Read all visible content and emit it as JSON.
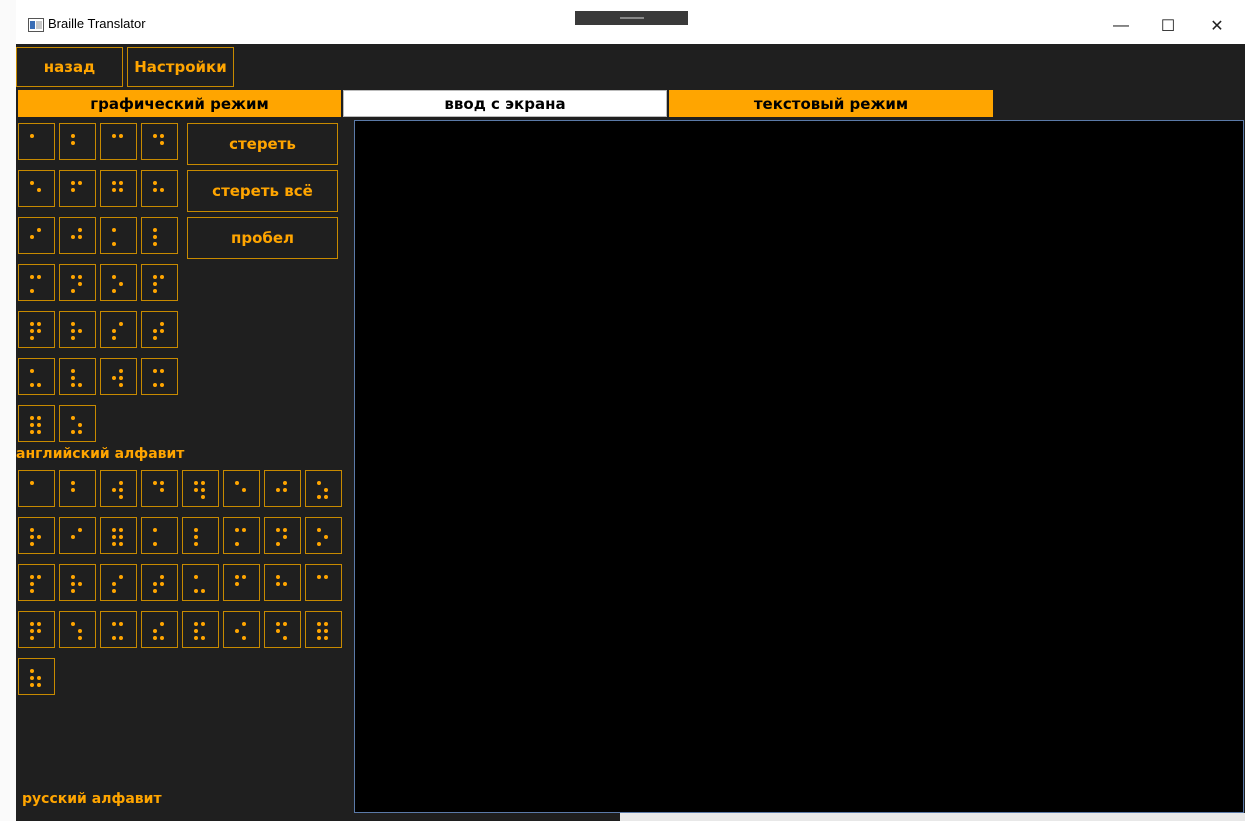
{
  "window": {
    "title": "Braille Translator",
    "controls": {
      "minimize": "—",
      "maximize": "☐",
      "close": "✕"
    }
  },
  "nav": {
    "back": "назад",
    "settings": "Настройки"
  },
  "tabs": [
    {
      "label": "графический режим",
      "active": false
    },
    {
      "label": "ввод с экрана",
      "active": true
    },
    {
      "label": "текстовый режим",
      "active": false
    }
  ],
  "actions": {
    "erase": "стереть",
    "erase_all": "стереть всё",
    "space": "пробел"
  },
  "sections": {
    "english": "английский алфавит",
    "russian": "русский алфавит"
  },
  "colors": {
    "accent": "#ffa500",
    "border": "#c78a00",
    "background": "#1f1f1f",
    "canvas": "#000000"
  },
  "english_cells": [
    [
      1
    ],
    [
      1,
      2
    ],
    [
      1,
      4
    ],
    [
      1,
      4,
      5
    ],
    [
      1,
      5
    ],
    [
      1,
      2,
      4
    ],
    [
      1,
      2,
      4,
      5
    ],
    [
      1,
      2,
      5
    ],
    [
      2,
      4
    ],
    [
      2,
      4,
      5
    ],
    [
      1,
      3
    ],
    [
      1,
      2,
      3
    ],
    [
      1,
      3,
      4
    ],
    [
      1,
      3,
      4,
      5
    ],
    [
      1,
      3,
      5
    ],
    [
      1,
      2,
      3,
      4
    ],
    [
      1,
      2,
      3,
      4,
      5
    ],
    [
      1,
      2,
      3,
      5
    ],
    [
      2,
      3,
      4
    ],
    [
      2,
      3,
      4,
      5
    ],
    [
      1,
      3,
      6
    ],
    [
      1,
      2,
      3,
      6
    ],
    [
      2,
      4,
      5,
      6
    ],
    [
      1,
      3,
      4,
      6
    ],
    [
      1,
      2,
      3,
      4,
      5,
      6
    ],
    [
      1,
      3,
      5,
      6
    ]
  ],
  "russian_cells": [
    [
      1
    ],
    [
      1,
      2
    ],
    [
      2,
      4,
      5,
      6
    ],
    [
      1,
      4,
      5
    ],
    [
      1,
      2,
      4,
      5,
      6
    ],
    [
      1,
      5
    ],
    [
      2,
      4,
      5
    ],
    [
      1,
      3,
      5,
      6
    ],
    [
      1,
      2,
      3,
      5
    ],
    [
      2,
      4
    ],
    [
      1,
      2,
      3,
      4,
      5,
      6
    ],
    [
      1,
      3
    ],
    [
      1,
      2,
      3
    ],
    [
      1,
      3,
      4
    ],
    [
      1,
      3,
      4,
      5
    ],
    [
      1,
      3,
      5
    ],
    [
      1,
      2,
      3,
      4
    ],
    [
      1,
      2,
      3,
      5
    ],
    [
      2,
      3,
      4
    ],
    [
      2,
      3,
      4,
      5
    ],
    [
      1,
      3,
      6
    ],
    [
      1,
      2,
      4
    ],
    [
      1,
      2,
      5
    ],
    [
      1,
      4
    ],
    [
      1,
      2,
      3,
      4,
      5
    ],
    [
      1,
      5,
      6
    ],
    [
      1,
      3,
      4,
      6
    ],
    [
      2,
      3,
      4,
      6
    ],
    [
      1,
      2,
      3,
      4,
      6
    ],
    [
      2,
      4,
      6
    ],
    [
      1,
      2,
      4,
      6
    ],
    [
      1,
      2,
      3,
      4,
      5,
      6
    ],
    [
      1,
      2,
      3,
      5,
      6
    ]
  ]
}
